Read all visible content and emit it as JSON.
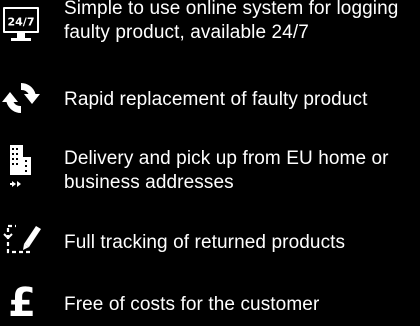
{
  "features": [
    {
      "icon": "monitor-24-7-icon",
      "icon_text": "24/7",
      "text": "Simple to use online system for logging faulty product, available 24/7"
    },
    {
      "icon": "refresh-arrows-icon",
      "text": "Rapid replacement of faulty product"
    },
    {
      "icon": "building-delivery-icon",
      "text": "Delivery and pick up from EU home or business addresses"
    },
    {
      "icon": "tracking-pencil-icon",
      "text": "Full tracking of returned products"
    },
    {
      "icon": "pound-sign-icon",
      "icon_text": "£",
      "text": "Free of costs for the customer"
    }
  ],
  "colors": {
    "background": "#000000",
    "foreground": "#ffffff"
  }
}
